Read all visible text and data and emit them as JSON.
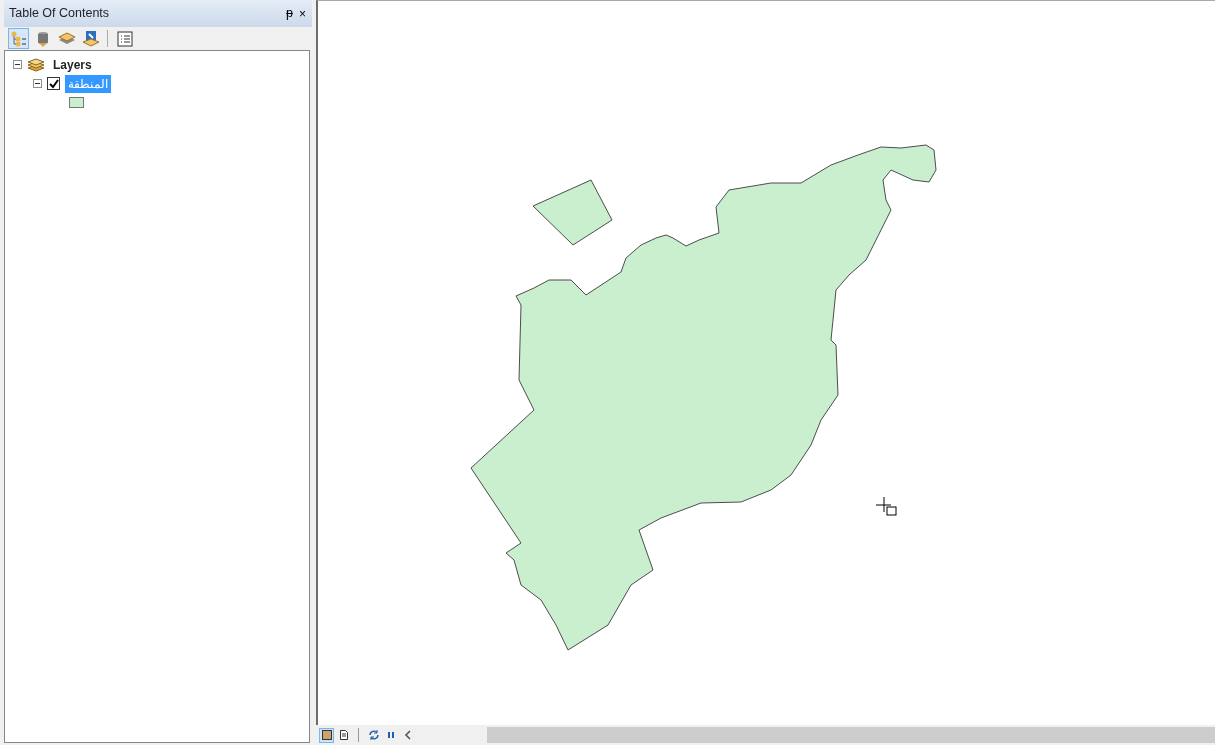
{
  "panel": {
    "title": "Table Of Contents",
    "pin": "ᵽ",
    "close": "×"
  },
  "toolbar": [
    {
      "kind": "list-by-drawing-order",
      "selected": true
    },
    {
      "kind": "list-by-source",
      "selected": false
    },
    {
      "kind": "list-by-visibility",
      "selected": false
    },
    {
      "kind": "list-by-selection",
      "selected": false
    },
    {
      "kind": "options",
      "selected": false
    }
  ],
  "tree": [
    {
      "label": "Layers",
      "kind": "frame",
      "expanded": true,
      "children": [
        {
          "label": "المنطقة",
          "kind": "layer",
          "checked": true,
          "selected": true,
          "expanded": true,
          "children": [
            {
              "kind": "symbol",
              "color": "#c9efce"
            }
          ]
        }
      ]
    }
  ],
  "map": {
    "features": [
      {
        "kind": "polygon",
        "color": "#c9efce"
      }
    ]
  },
  "status_bar": [
    {
      "kind": "data-view",
      "selected": true
    },
    {
      "kind": "layout-view",
      "selected": false
    },
    {
      "kind": "refresh",
      "selected": false
    },
    {
      "kind": "pause",
      "selected": false
    },
    {
      "kind": "back",
      "selected": false
    }
  ]
}
